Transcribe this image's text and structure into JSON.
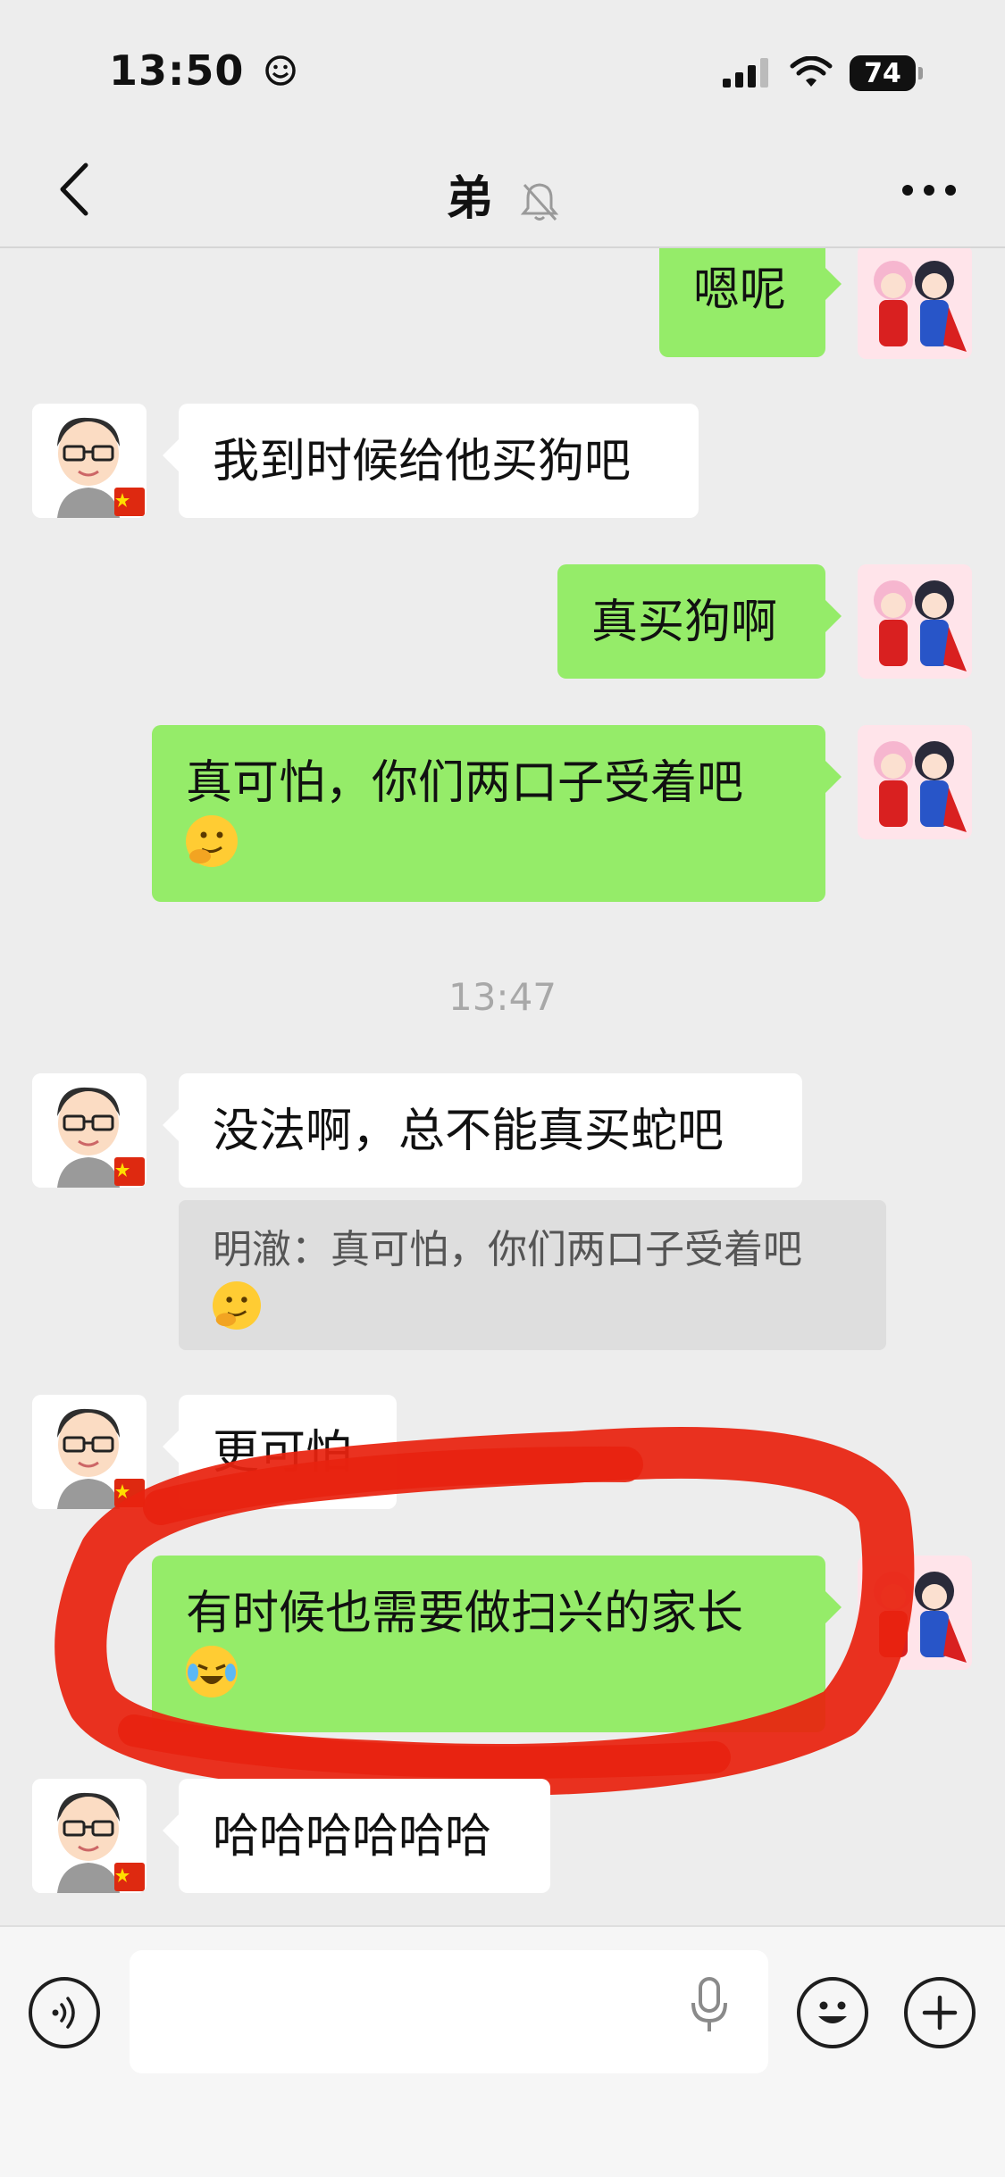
{
  "status": {
    "time": "13:50",
    "battery": "74"
  },
  "nav": {
    "title": "弟"
  },
  "messages": [
    {
      "side": "out",
      "text": "嗯呢"
    },
    {
      "side": "in",
      "text": "我到时候给他买狗吧"
    },
    {
      "side": "out",
      "text": "真买狗啊"
    },
    {
      "side": "out",
      "text": "真可怕，你们两口子受着吧"
    },
    {
      "timestamp": "13:47"
    },
    {
      "side": "in",
      "text": "没法啊，总不能真买蛇吧"
    },
    {
      "quote": "明澈：真可怕，你们两口子受着吧"
    },
    {
      "side": "in",
      "text": "更可怕"
    },
    {
      "side": "out",
      "text": "有时候也需要做扫兴的家长"
    },
    {
      "side": "in",
      "text": "哈哈哈哈哈哈"
    }
  ],
  "colors": {
    "out_bubble": "#95ec69",
    "in_bubble": "#ffffff",
    "background": "#ededed",
    "annotation": "#e8220f"
  },
  "icons": [
    "back-icon",
    "mute-bell-icon",
    "more-icon",
    "voice-icon",
    "microphone-icon",
    "emoji-icon",
    "plus-icon",
    "face-emoji-icon",
    "laugh-cry-emoji-icon"
  ]
}
